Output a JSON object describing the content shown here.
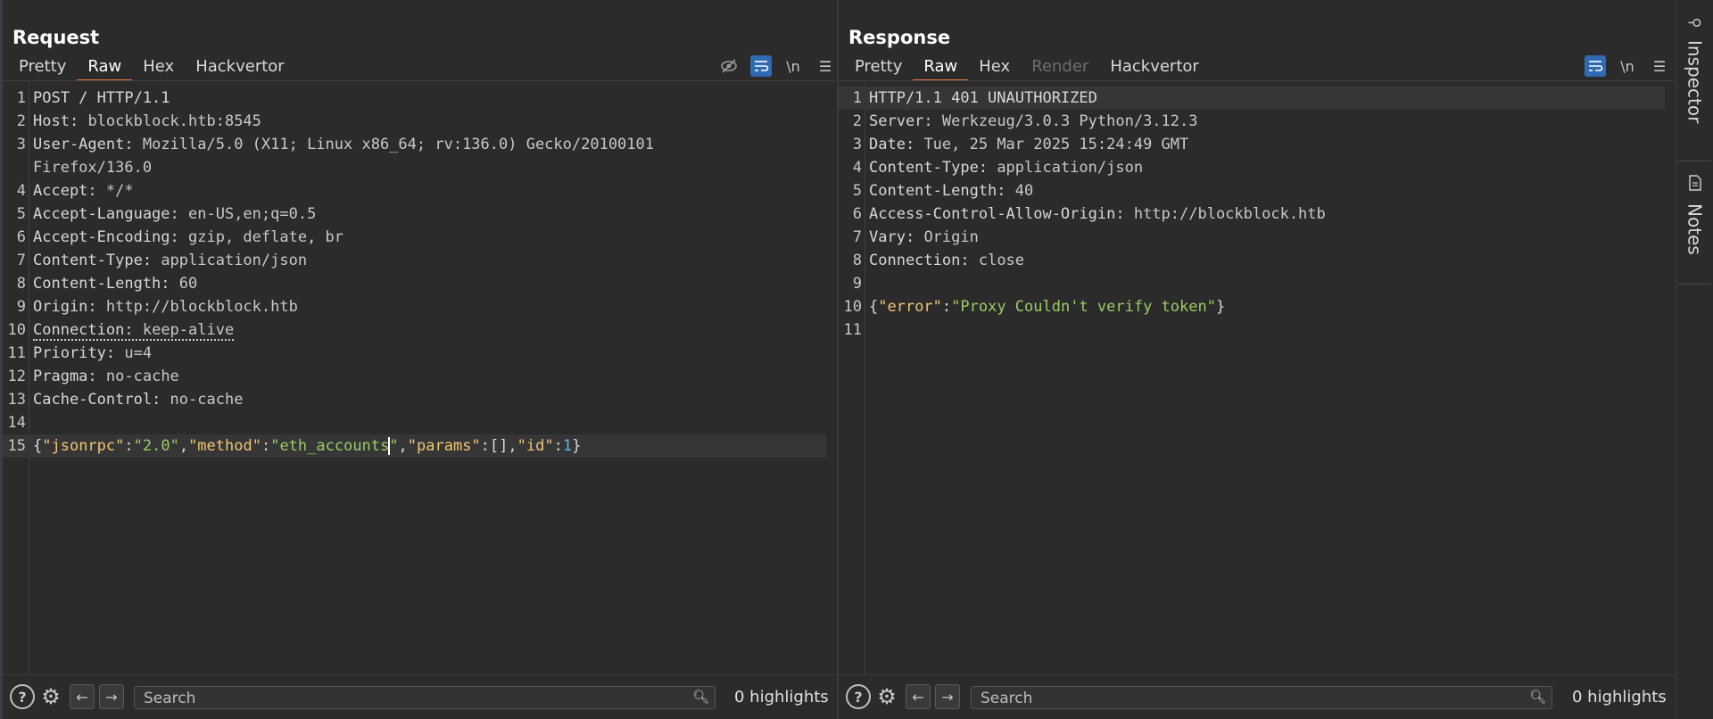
{
  "request": {
    "title": "Request",
    "tabs": [
      "Pretty",
      "Raw",
      "Hex",
      "Hackvertor"
    ],
    "active_tab": "Raw",
    "lines": [
      {
        "n": "1",
        "k": "POST / HTTP/1.1",
        "v": ""
      },
      {
        "n": "2",
        "k": "Host",
        "v": "blockblock.htb:8545"
      },
      {
        "n": "3",
        "k": "User-Agent",
        "v": "Mozilla/5.0 (X11; Linux x86_64; rv:136.0) Gecko/20100101 Firefox/136.0"
      },
      {
        "n": "4",
        "k": "Accept",
        "v": "*/*"
      },
      {
        "n": "5",
        "k": "Accept-Language",
        "v": "en-US,en;q=0.5"
      },
      {
        "n": "6",
        "k": "Accept-Encoding",
        "v": "gzip, deflate, br"
      },
      {
        "n": "7",
        "k": "Content-Type",
        "v": "application/json"
      },
      {
        "n": "8",
        "k": "Content-Length",
        "v": "60"
      },
      {
        "n": "9",
        "k": "Origin",
        "v": "http://blockblock.htb"
      },
      {
        "n": "10",
        "k": "Connection",
        "v": "keep-alive"
      },
      {
        "n": "11",
        "k": "Priority",
        "v": "u=4"
      },
      {
        "n": "12",
        "k": "Pragma",
        "v": "no-cache"
      },
      {
        "n": "13",
        "k": "Cache-Control",
        "v": "no-cache"
      },
      {
        "n": "14",
        "k": "",
        "v": ""
      }
    ],
    "body_line": {
      "n": "15",
      "k1": "\"jsonrpc\"",
      "v1": "\"2.0\"",
      "k2": "\"method\"",
      "v2a": "\"eth_accounts",
      "v2b": "\"",
      "k3": "\"params\"",
      "v3": "[]",
      "k4": "\"id\"",
      "v4": "1"
    },
    "search_placeholder": "Search",
    "highlights": "0 highlights"
  },
  "response": {
    "title": "Response",
    "tabs": [
      "Pretty",
      "Raw",
      "Hex",
      "Render",
      "Hackvertor"
    ],
    "active_tab": "Raw",
    "lines": [
      {
        "n": "1",
        "k": "HTTP/1.1 401 UNAUTHORIZED",
        "v": ""
      },
      {
        "n": "2",
        "k": "Server",
        "v": "Werkzeug/3.0.3 Python/3.12.3"
      },
      {
        "n": "3",
        "k": "Date",
        "v": "Tue, 25 Mar 2025 15:24:49 GMT"
      },
      {
        "n": "4",
        "k": "Content-Type",
        "v": "application/json"
      },
      {
        "n": "5",
        "k": "Content-Length",
        "v": "40"
      },
      {
        "n": "6",
        "k": "Access-Control-Allow-Origin",
        "v": "http://blockblock.htb"
      },
      {
        "n": "7",
        "k": "Vary",
        "v": "Origin"
      },
      {
        "n": "8",
        "k": "Connection",
        "v": "close"
      },
      {
        "n": "9",
        "k": "",
        "v": ""
      }
    ],
    "body_line": {
      "n": "10",
      "k": "\"error\"",
      "v": "\"Proxy Couldn't verify token\""
    },
    "last_line": {
      "n": "11"
    },
    "search_placeholder": "Search",
    "highlights": "0 highlights"
  },
  "sidebar": {
    "inspector": "Inspector",
    "notes": "Notes"
  },
  "icons": {
    "hide": "eye-slash-icon",
    "wrap": "wrap-lines-icon",
    "newline": "\\n",
    "menu": "hamburger-menu-icon"
  },
  "colors": {
    "accent_tab": "#e8743b",
    "toggle_on": "#2f6ab3",
    "json_key": "#f0c674",
    "json_string": "#9ccc65",
    "json_number": "#5fb3e8"
  }
}
